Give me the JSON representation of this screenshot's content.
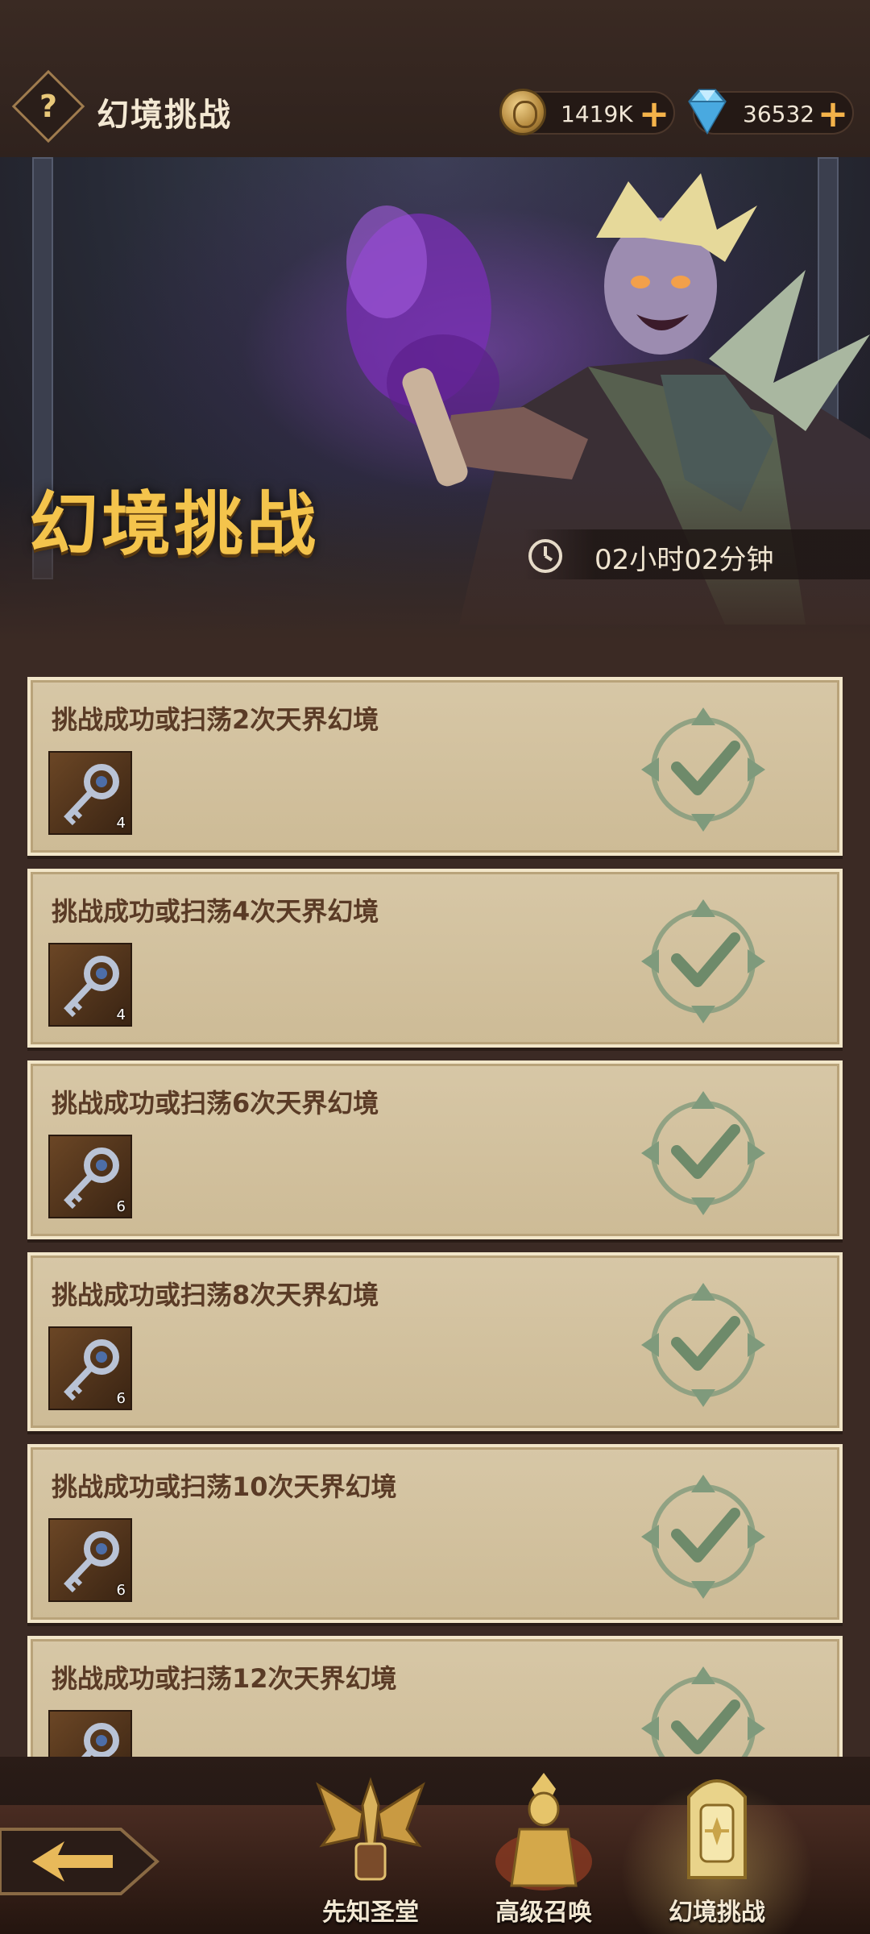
{
  "header": {
    "title": "幻境挑战",
    "help_icon": "question-mark-icon",
    "gold": "1419K",
    "gems": "36532"
  },
  "banner": {
    "title": "幻境挑战",
    "timer": "02小时02分钟"
  },
  "tasks": [
    {
      "title": "挑战成功或扫荡2次天界幻境",
      "reward_icon": "key-icon",
      "reward_qty": "4",
      "status_icon": "completed-check-icon"
    },
    {
      "title": "挑战成功或扫荡4次天界幻境",
      "reward_icon": "key-icon",
      "reward_qty": "4",
      "status_icon": "completed-check-icon"
    },
    {
      "title": "挑战成功或扫荡6次天界幻境",
      "reward_icon": "key-icon",
      "reward_qty": "6",
      "status_icon": "completed-check-icon"
    },
    {
      "title": "挑战成功或扫荡8次天界幻境",
      "reward_icon": "key-icon",
      "reward_qty": "6",
      "status_icon": "completed-check-icon"
    },
    {
      "title": "挑战成功或扫荡10次天界幻境",
      "reward_icon": "key-icon",
      "reward_qty": "6",
      "status_icon": "completed-check-icon"
    },
    {
      "title": "挑战成功或扫荡12次天界幻境",
      "reward_icon": "key-icon",
      "reward_qty": "",
      "status_icon": "completed-check-icon"
    }
  ],
  "nav": {
    "tabs": [
      {
        "label": "先知圣堂",
        "icon": "winged-sword-icon"
      },
      {
        "label": "高级召唤",
        "icon": "golden-angel-icon"
      },
      {
        "label": "幻境挑战",
        "icon": "golden-throne-icon",
        "active": true
      }
    ],
    "back_icon": "back-arrow-icon"
  },
  "colors": {
    "accent_gold": "#f4c44c",
    "card_bg": "#d7c7a6",
    "check_green": "#6e8a6a"
  }
}
